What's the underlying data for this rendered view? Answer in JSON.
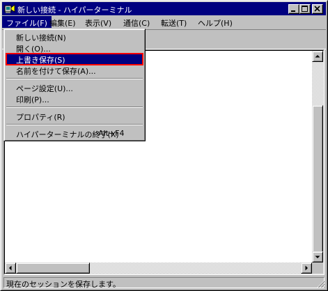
{
  "window": {
    "title": "新しい接続 - ハイパーターミナル"
  },
  "menubar": {
    "items": [
      "ファイル(F)",
      "編集(E)",
      "表示(V)",
      "通信(C)",
      "転送(T)",
      "ヘルプ(H)"
    ],
    "active_index": 0
  },
  "file_menu": {
    "items": [
      {
        "label": "新しい接続(N)"
      },
      {
        "label": "開く(O)..."
      },
      {
        "label": "上書き保存(S)",
        "selected": true
      },
      {
        "label": "名前を付けて保存(A)..."
      },
      {
        "label": "ページ設定(U)..."
      },
      {
        "label": "印刷(P)..."
      },
      {
        "label": "プロパティ(R)"
      },
      {
        "label": "ハイパーターミナルの終了(X)",
        "shortcut": "Alt+F4"
      }
    ]
  },
  "statusbar": {
    "text": "現在のセッションを保存します。"
  },
  "colors": {
    "titlebar": "#000080",
    "highlight": "#000080",
    "face": "#c0c0c0",
    "selection_outline": "#ff0000"
  }
}
